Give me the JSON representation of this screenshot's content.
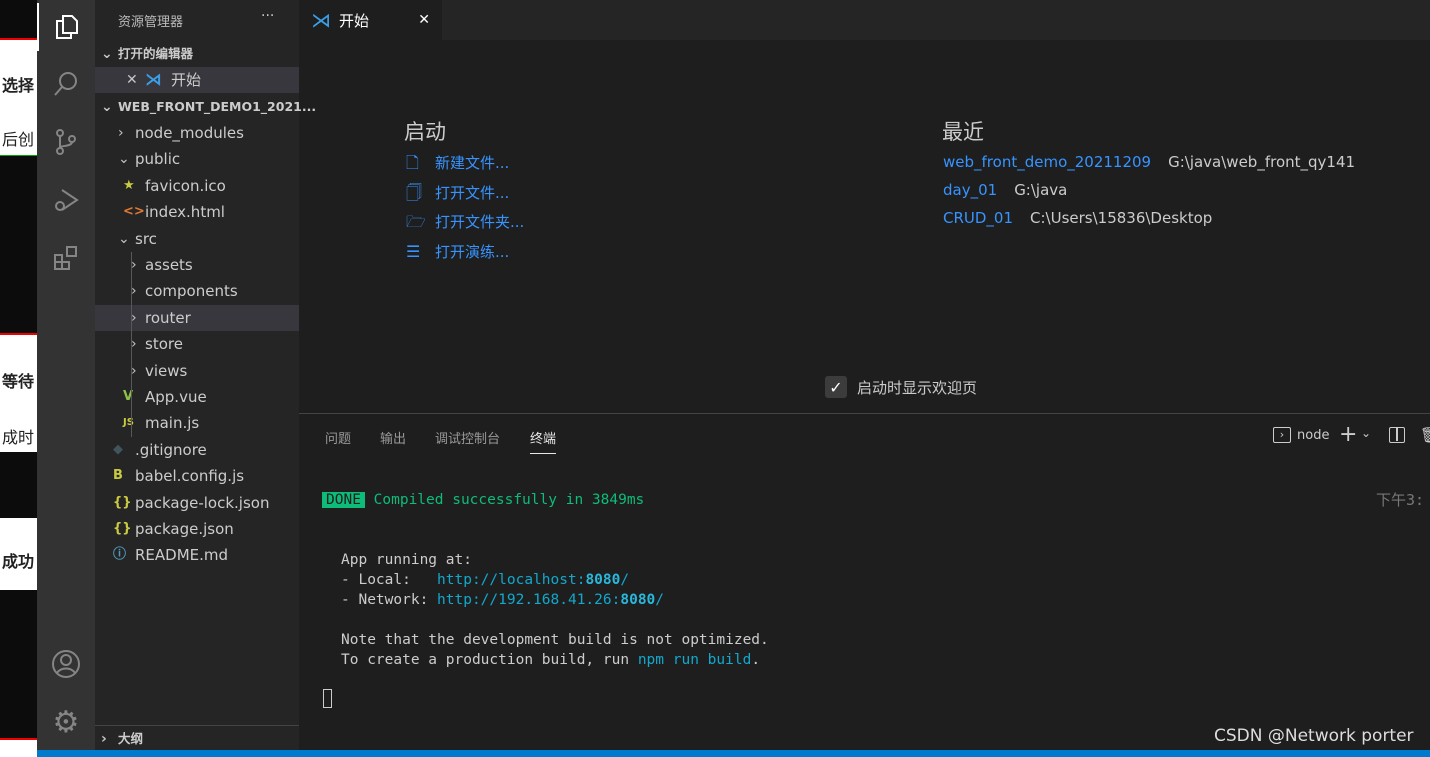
{
  "background_window": {
    "fragments": [
      "选择",
      "后创",
      "等待",
      "成时",
      "成功"
    ]
  },
  "activity_bar": {
    "items": [
      "explorer",
      "search",
      "source-control",
      "run-debug",
      "extensions"
    ],
    "bottom": [
      "accounts",
      "manage"
    ]
  },
  "sidebar": {
    "title": "资源管理器",
    "more": "···",
    "open_editors_header": "打开的编辑器",
    "open_editors": [
      {
        "label": "开始"
      }
    ],
    "project_header": "WEB_FRONT_DEMO1_2021...",
    "tree": [
      {
        "label": "node_modules",
        "type": "folder",
        "expanded": false
      },
      {
        "label": "public",
        "type": "folder",
        "expanded": true
      },
      {
        "label": "favicon.ico",
        "type": "file",
        "icon": "star"
      },
      {
        "label": "index.html",
        "type": "file",
        "icon": "<>"
      },
      {
        "label": "src",
        "type": "folder",
        "expanded": true
      },
      {
        "label": "assets",
        "type": "folder",
        "expanded": false
      },
      {
        "label": "components",
        "type": "folder",
        "expanded": false
      },
      {
        "label": "router",
        "type": "folder",
        "expanded": false,
        "selected": true
      },
      {
        "label": "store",
        "type": "folder",
        "expanded": false
      },
      {
        "label": "views",
        "type": "folder",
        "expanded": false
      },
      {
        "label": "App.vue",
        "type": "file",
        "icon": "V"
      },
      {
        "label": "main.js",
        "type": "file",
        "icon": "JS"
      },
      {
        "label": ".gitignore",
        "type": "file",
        "icon": "◆"
      },
      {
        "label": "babel.config.js",
        "type": "file",
        "icon": "B"
      },
      {
        "label": "package-lock.json",
        "type": "file",
        "icon": "{}"
      },
      {
        "label": "package.json",
        "type": "file",
        "icon": "{}"
      },
      {
        "label": "README.md",
        "type": "file",
        "icon": "ⓘ"
      }
    ],
    "outline_header": "大纲"
  },
  "editor": {
    "tab": {
      "label": "开始"
    },
    "start": {
      "title": "启动",
      "items": [
        "新建文件...",
        "打开文件...",
        "打开文件夹...",
        "打开演练..."
      ]
    },
    "recent": {
      "title": "最近",
      "items": [
        {
          "name": "web_front_demo_20211209",
          "path": "G:\\java\\web_front_qy141"
        },
        {
          "name": "day_01",
          "path": "G:\\java"
        },
        {
          "name": "CRUD_01",
          "path": "C:\\Users\\15836\\Desktop"
        }
      ]
    },
    "show_on_startup": {
      "label": "启动时显示欢迎页",
      "checked": true
    }
  },
  "panel": {
    "tabs": [
      "问题",
      "输出",
      "调试控制台",
      "终端"
    ],
    "active_tab": "终端",
    "terminal_name": "node",
    "timestamp": "下午3:",
    "lines": {
      "done_badge": "DONE",
      "compiled": "Compiled successfully in 3849ms",
      "app_running": "App running at:",
      "local_label": "- Local:   ",
      "local_url": "http://localhost:",
      "local_port": "8080",
      "local_slash": "/",
      "network_label": "- Network: ",
      "network_url": "http://192.168.41.26:",
      "network_port": "8080",
      "network_slash": "/",
      "note": "Note that the development build is not optimized.",
      "prod_prefix": "To create a production build, run ",
      "prod_cmd": "npm run build",
      "prod_suffix": "."
    }
  },
  "colors": {
    "accent": "#007acc",
    "link": "#3794ff",
    "done": "#0dbc79"
  },
  "watermark": "CSDN @Network porter"
}
